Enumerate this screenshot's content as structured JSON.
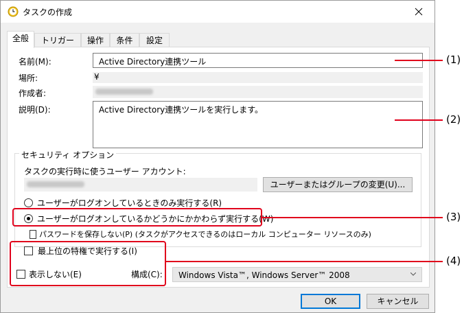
{
  "window": {
    "title": "タスクの作成",
    "icon": "clock-icon"
  },
  "tabs": [
    {
      "label": "全般",
      "active": true
    },
    {
      "label": "トリガー",
      "active": false
    },
    {
      "label": "操作",
      "active": false
    },
    {
      "label": "条件",
      "active": false
    },
    {
      "label": "設定",
      "active": false
    }
  ],
  "general": {
    "name_label": "名前(M):",
    "name_value": "Active Directory連携ツール",
    "location_label": "場所:",
    "location_value": "¥",
    "author_label": "作成者:",
    "description_label": "説明(D):",
    "description_value": "Active Directory連携ツールを実行します。"
  },
  "security": {
    "group_title": "セキュリティ オプション",
    "account_label": "タスクの実行時に使うユーザー アカウント:",
    "change_user_button": "ユーザーまたはグループの変更(U)...",
    "radio_logged_on_only": "ユーザーがログオンしているときのみ実行する(R)",
    "radio_whether_or_not": "ユーザーがログオンしているかどうかにかかわらず実行する(W)",
    "selected_option": "whether_or_not",
    "do_not_store_password": "パスワードを保存しない(P) (タスクがアクセスできるのはローカル コンピューター リソースのみ)",
    "run_highest_privileges": "最上位の特権で実行する(I)",
    "hidden_label": "表示しない(E)",
    "configure_label": "構成(C):",
    "configure_value": "Windows Vista™, Windows Server™ 2008"
  },
  "footer": {
    "ok_button": "OK",
    "cancel_button": "キャンセル"
  },
  "callouts": [
    "(1)",
    "(2)",
    "(3)",
    "(4)"
  ],
  "colors": {
    "annotation_red": "#e0001b",
    "focus_blue": "#0078d7"
  }
}
